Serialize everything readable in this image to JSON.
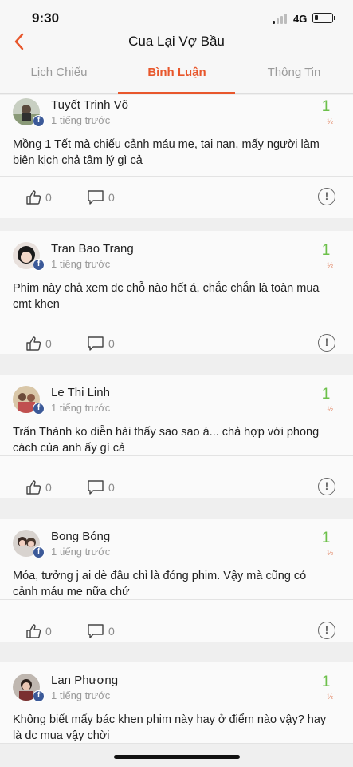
{
  "status_bar": {
    "time": "9:30",
    "network": "4G"
  },
  "header": {
    "title": "Cua Lại Vợ Bầu"
  },
  "tabs": [
    {
      "label": "Lịch Chiếu",
      "active": false
    },
    {
      "label": "Bình Luận",
      "active": true
    },
    {
      "label": "Thông Tin",
      "active": false
    }
  ],
  "colors": {
    "accent": "#e8572c",
    "score": "#6cc04a",
    "facebook": "#3b5998"
  },
  "comments": [
    {
      "user": "Tuyết Trinh Võ",
      "time": "1 tiếng trước",
      "score": "1",
      "score_max": "½",
      "text": "Mồng 1 Tết mà chiếu cảnh máu me, tai nạn, mấy người làm biên kịch chả tâm lý gì cả",
      "likes": "0",
      "replies": "0"
    },
    {
      "user": "Tran Bao Trang",
      "time": "1 tiếng trước",
      "score": "1",
      "score_max": "½",
      "text": "Phim này chả xem dc chỗ nào hết á, chắc chắn là toàn mua cmt khen",
      "likes": "0",
      "replies": "0"
    },
    {
      "user": "Le Thi Linh",
      "time": "1 tiếng trước",
      "score": "1",
      "score_max": "½",
      "text": "Trấn Thành ko diễn hài thấy sao sao á... chả hợp với phong cách của anh ấy gì cả",
      "likes": "0",
      "replies": "0"
    },
    {
      "user": "Bong Bóng",
      "time": "1 tiếng trước",
      "score": "1",
      "score_max": "½",
      "text": "Móa, tưởng j ai dè đâu chỉ là đóng phim. Vậy mà cũng có cảnh máu me nữa chứ",
      "likes": "0",
      "replies": "0"
    },
    {
      "user": "Lan Phương",
      "time": "1 tiếng trước",
      "score": "1",
      "score_max": "½",
      "text": "Không biết mấy bác khen phim này hay ở điểm nào vậy? hay là dc mua vậy chời",
      "likes": "0",
      "replies": "0"
    }
  ],
  "icons": {
    "back": "chevron-left-icon",
    "like": "thumbs-up-icon",
    "reply": "comment-bubble-icon",
    "report": "exclamation-circle-icon",
    "facebook": "facebook-badge-icon"
  }
}
